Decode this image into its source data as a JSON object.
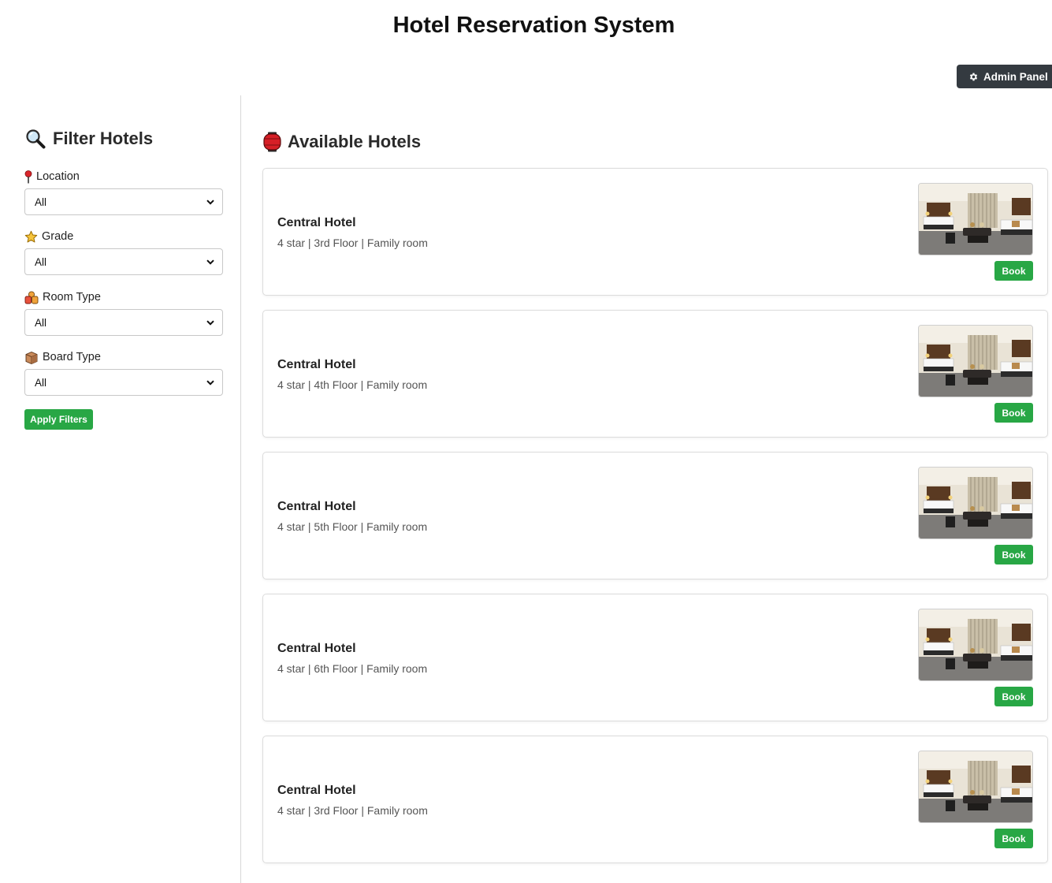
{
  "header": {
    "title": "Hotel Reservation System",
    "admin_button_label": "Admin Panel",
    "admin_button_icon": "gear-icon"
  },
  "sidebar": {
    "heading": "Filter Hotels",
    "heading_icon": "magnifier-icon",
    "filters": [
      {
        "label": "Location",
        "icon": "pin-icon",
        "value": "All"
      },
      {
        "label": "Grade",
        "icon": "star-icon",
        "value": "All"
      },
      {
        "label": "Room Type",
        "icon": "room-type-icon",
        "value": "All"
      },
      {
        "label": "Board Type",
        "icon": "box-icon",
        "value": "All"
      }
    ],
    "apply_label": "Apply Filters"
  },
  "main": {
    "heading": "Available Hotels",
    "heading_icon": "lantern-icon",
    "hotels": [
      {
        "name": "Central Hotel",
        "details": "4 star | 3rd Floor | Family room",
        "book_label": "Book"
      },
      {
        "name": "Central Hotel",
        "details": "4 star | 4th Floor | Family room",
        "book_label": "Book"
      },
      {
        "name": "Central Hotel",
        "details": "4 star | 5th Floor | Family room",
        "book_label": "Book"
      },
      {
        "name": "Central Hotel",
        "details": "4 star | 6th Floor | Family room",
        "book_label": "Book"
      },
      {
        "name": "Central Hotel",
        "details": "4 star | 3rd Floor | Family room",
        "book_label": "Book"
      }
    ]
  },
  "colors": {
    "accent_green": "#28a745",
    "admin_dark": "#343a40"
  }
}
